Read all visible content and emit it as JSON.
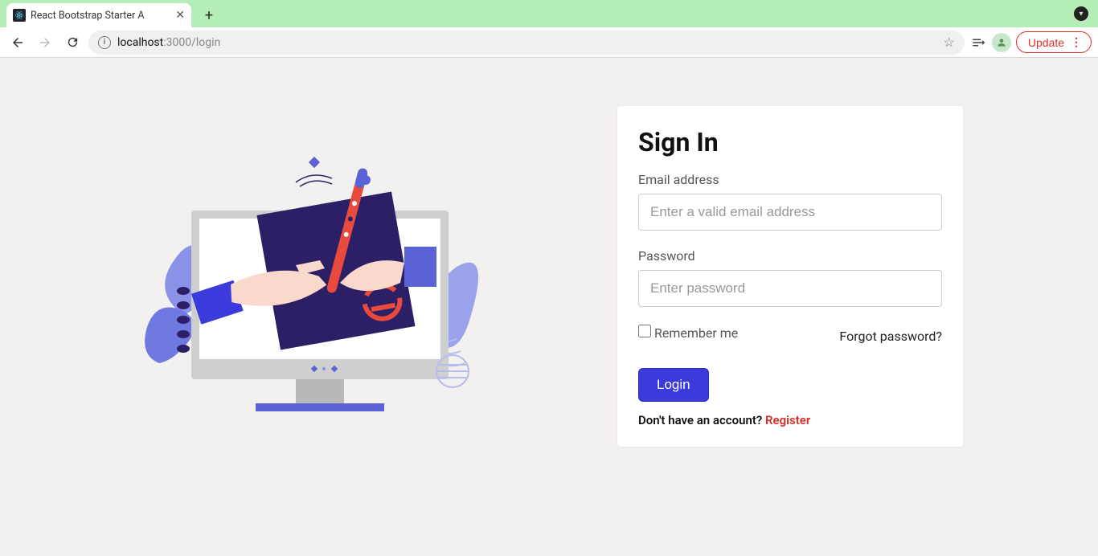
{
  "browser": {
    "tab_title": "React Bootstrap Starter A",
    "url_host": "localhost",
    "url_rest": ":3000/login",
    "update_label": "Update"
  },
  "login": {
    "title": "Sign In",
    "email_label": "Email address",
    "email_placeholder": "Enter a valid email address",
    "password_label": "Password",
    "password_placeholder": "Enter password",
    "remember_label": "Remember me",
    "forgot_label": "Forgot password?",
    "login_button": "Login",
    "no_account_text": "Don't have an account? ",
    "register_label": "Register"
  },
  "colors": {
    "primary": "#3b3bdb",
    "danger": "#d72c2c",
    "chrome_accent": "#b4edb6"
  }
}
